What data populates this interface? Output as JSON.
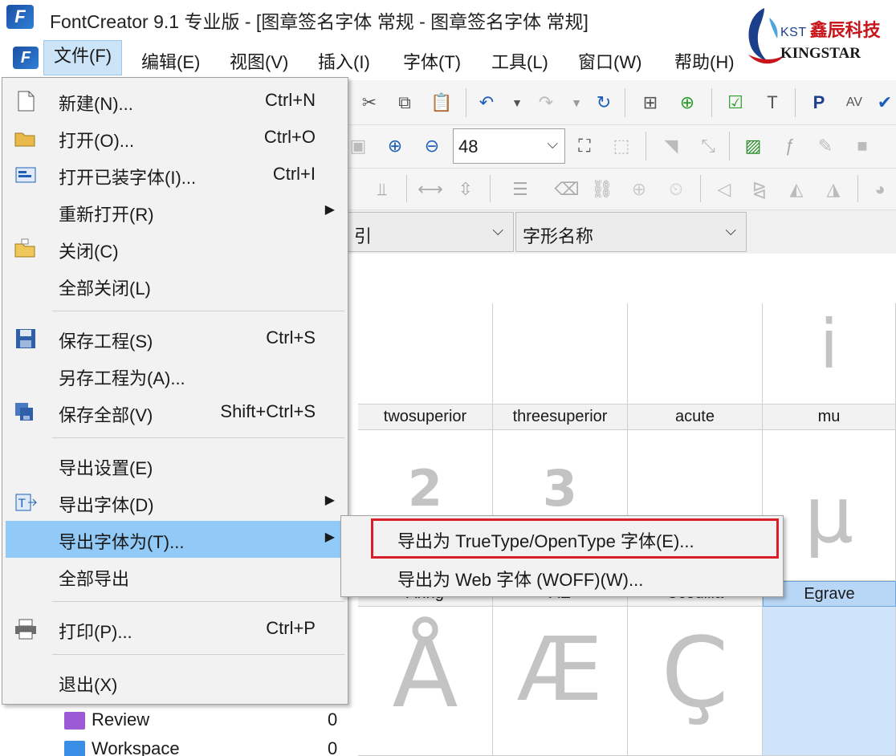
{
  "window": {
    "title": "FontCreator 9.1 专业版  - [图章签名字体 常规 - 图章签名字体 常规]"
  },
  "brand": {
    "kst": "KST",
    "name_cn": "鑫辰科技",
    "name_en": "KINGSTAR"
  },
  "menubar": {
    "items": [
      "文件(F)",
      "编辑(E)",
      "视图(V)",
      "插入(I)",
      "字体(T)",
      "工具(L)",
      "窗口(W)",
      "帮助(H)"
    ]
  },
  "toolbar": {
    "zoom_value": "48"
  },
  "filters": {
    "combo1_label": "引",
    "combo2_label": "字形名称"
  },
  "glyphs": {
    "row1_labels": [
      "twosuperior",
      "threesuperior",
      "acute",
      "mu"
    ],
    "row1_chars": [
      "",
      "",
      "",
      "i"
    ],
    "row2_chars": [
      "2",
      "3",
      "",
      "μ"
    ],
    "row2_labels": [
      "Aring",
      "AE",
      "Ccedilla",
      "Egrave"
    ],
    "row3_chars": [
      "Å",
      "Æ",
      "Ç",
      ""
    ]
  },
  "tree": {
    "items": [
      {
        "label": "Review",
        "count": "0",
        "color": "#9b59d6"
      },
      {
        "label": "Workspace",
        "count": "0",
        "color": "#3a8ee6"
      }
    ]
  },
  "file_menu": {
    "new": {
      "label": "新建(N)...",
      "shortcut": "Ctrl+N"
    },
    "open": {
      "label": "打开(O)...",
      "shortcut": "Ctrl+O"
    },
    "open_installed": {
      "label": "打开已装字体(I)...",
      "shortcut": "Ctrl+I"
    },
    "reopen": {
      "label": "重新打开(R)"
    },
    "close": {
      "label": "关闭(C)"
    },
    "close_all": {
      "label": "全部关闭(L)"
    },
    "save_project": {
      "label": "保存工程(S)",
      "shortcut": "Ctrl+S"
    },
    "save_project_as": {
      "label": "另存工程为(A)..."
    },
    "save_all": {
      "label": "保存全部(V)",
      "shortcut": "Shift+Ctrl+S"
    },
    "export_settings": {
      "label": "导出设置(E)"
    },
    "export_font": {
      "label": "导出字体(D)"
    },
    "export_font_as": {
      "label": "导出字体为(T)..."
    },
    "export_all": {
      "label": "全部导出"
    },
    "print": {
      "label": "打印(P)...",
      "shortcut": "Ctrl+P"
    },
    "exit": {
      "label": "退出(X)"
    }
  },
  "submenu": {
    "truetype": "导出为 TrueType/OpenType 字体(E)...",
    "woff": "导出为 Web 字体 (WOFF)(W)..."
  },
  "colors": {
    "highlight": "#91c9f7",
    "annotation_red": "#d9202a",
    "selected_cell": "#cfe3fa"
  }
}
